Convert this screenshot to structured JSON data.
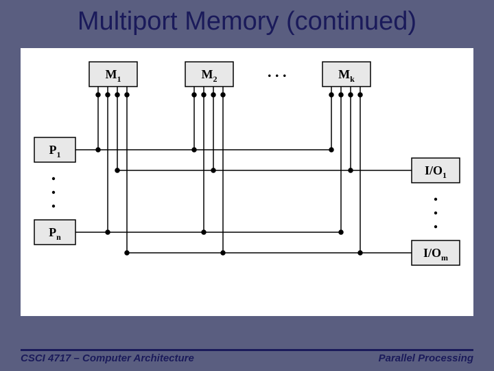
{
  "title": "Multiport Memory (continued)",
  "footer": {
    "left": "CSCI 4717 – Computer Architecture",
    "right": "Parallel Processing"
  },
  "memories": [
    {
      "label": "M",
      "sub": "1"
    },
    {
      "label": "M",
      "sub": "2"
    },
    {
      "label": "M",
      "sub": "k"
    }
  ],
  "processors": [
    {
      "label": "P",
      "sub": "1"
    },
    {
      "label": "P",
      "sub": "n"
    }
  ],
  "ios": [
    {
      "label": "I/O",
      "sub": "1"
    },
    {
      "label": "I/O",
      "sub": "m"
    }
  ],
  "ellipsis": ". . .",
  "chart_data": {
    "type": "diagram",
    "description": "Multiport memory interconnection: memory modules M1..Mk each provide dedicated ports directly wired to every processor P1..Pn and every I/O module I/O1..I/Om (crossbar-style direct links, junction dots at connections).",
    "memory_modules": [
      "M1",
      "M2",
      "…",
      "Mk"
    ],
    "processor_modules": [
      "P1",
      "…",
      "Pn"
    ],
    "io_modules": [
      "I/O1",
      "…",
      "I/Om"
    ],
    "links": "each memory module has one port per processor and one port per I/O module"
  }
}
